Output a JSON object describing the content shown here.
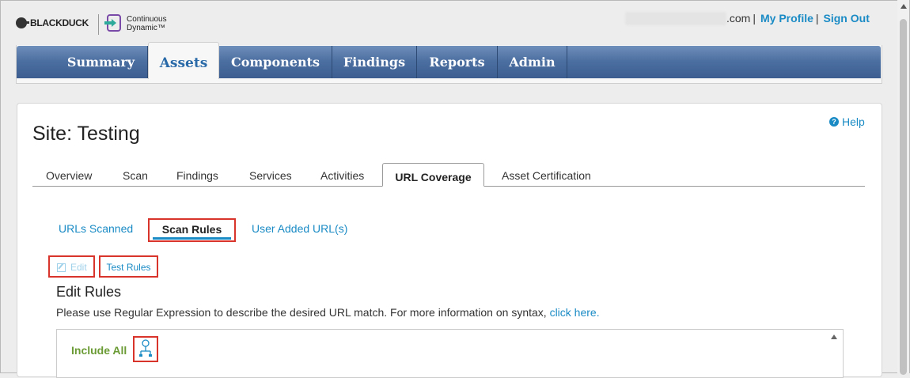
{
  "header": {
    "brand_left": "BLACKDUCK",
    "brand_right_line1": "Continuous",
    "brand_right_line2": "Dynamic™",
    "email_suffix": ".com",
    "my_profile": "My Profile",
    "sign_out": "Sign Out",
    "separator": "|"
  },
  "nav": {
    "items": [
      {
        "label": "Summary"
      },
      {
        "label": "Assets"
      },
      {
        "label": "Components"
      },
      {
        "label": "Findings"
      },
      {
        "label": "Reports"
      },
      {
        "label": "Admin"
      }
    ],
    "active": "Assets"
  },
  "page": {
    "help": "Help",
    "title": "Site: Testing"
  },
  "tabs": {
    "items": [
      {
        "label": "Overview"
      },
      {
        "label": "Scan"
      },
      {
        "label": "Findings"
      },
      {
        "label": "Services"
      },
      {
        "label": "Activities"
      },
      {
        "label": "URL Coverage"
      },
      {
        "label": "Asset Certification"
      }
    ],
    "active": "URL Coverage"
  },
  "subtabs": {
    "items": [
      {
        "label": "URLs Scanned"
      },
      {
        "label": "Scan Rules"
      },
      {
        "label": "User Added URL(s)"
      }
    ],
    "active": "Scan Rules"
  },
  "toolbar": {
    "edit": "Edit",
    "test_rules": "Test Rules"
  },
  "rules": {
    "heading": "Edit Rules",
    "description": "Please use Regular Expression to describe the desired URL match. For more information on syntax, ",
    "link": "click here.",
    "include_all": "Include All"
  },
  "icons": {
    "help": "help-circle-icon",
    "edit": "pencil-icon",
    "rule_tree": "sitemap-icon"
  },
  "colors": {
    "link": "#1a8bc5",
    "highlight": "#d9342b",
    "include_green": "#6b9b35",
    "nav_blue": "#4d70a2"
  }
}
